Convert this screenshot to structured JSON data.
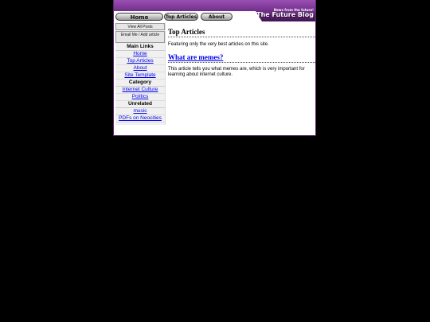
{
  "header": {
    "tagline": "News from the future!",
    "title": "The Future Blog"
  },
  "nav": {
    "home": "Home",
    "top_articles": "Top Articles",
    "about": "About"
  },
  "sidebar": {
    "view_all": "View All Posts",
    "email": "Email Me / Add article",
    "main_links_heading": "Main Links",
    "main_links": [
      "Home",
      "Top Articles",
      "About",
      "Site Template"
    ],
    "category_heading": "Category",
    "categories": [
      "Internet Culture",
      "Politics"
    ],
    "unrelated_heading": "Unrelated",
    "unrelated": [
      "music",
      "PDFs on Neocities"
    ]
  },
  "main": {
    "heading": "Top Articles",
    "intro": "Featuring only the very best articles on this site.",
    "article_title": "What are memes?",
    "article_text": "This article tells you what memes are, which is very important for learning about internet culture."
  }
}
